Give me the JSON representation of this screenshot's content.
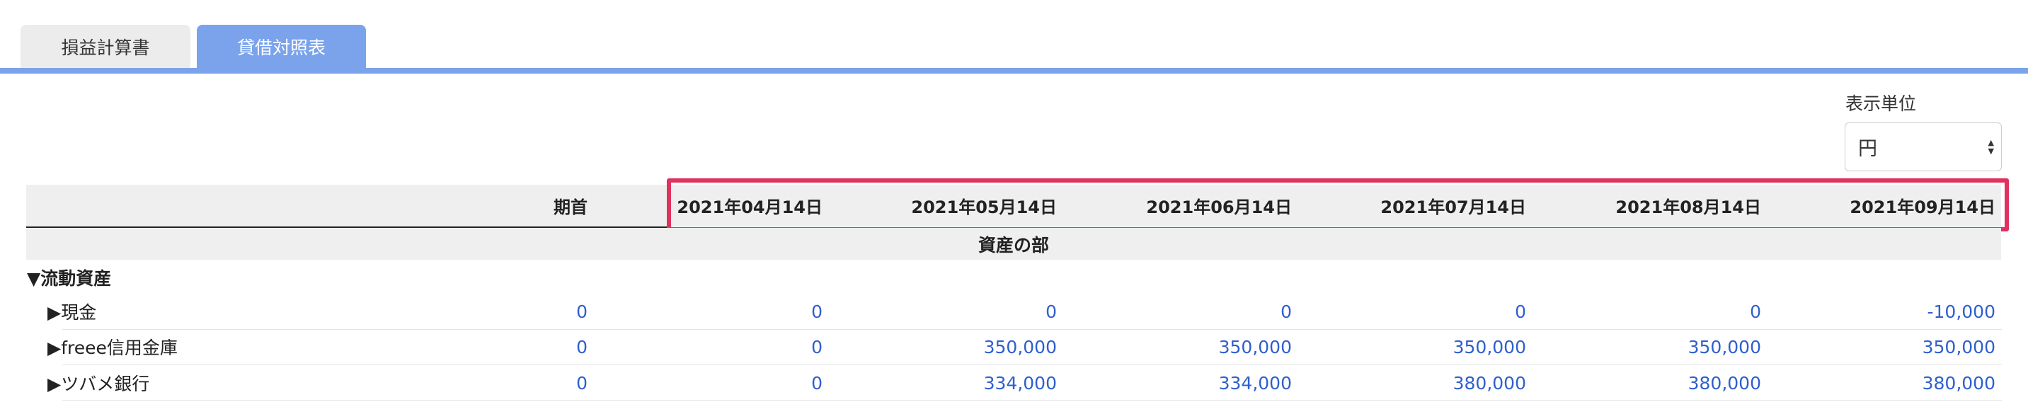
{
  "tabs": {
    "profit_loss": "損益計算書",
    "balance_sheet": "貸借対照表",
    "active": "balance_sheet"
  },
  "display_unit": {
    "label": "表示単位",
    "selected": "円"
  },
  "table": {
    "columns": [
      "期首",
      "2021年04月14日",
      "2021年05月14日",
      "2021年06月14日",
      "2021年07月14日",
      "2021年08月14日",
      "2021年09月14日"
    ],
    "section": "資産の部",
    "group": "▼流動資産",
    "rows": [
      {
        "name": "▶現金",
        "values": [
          "0",
          "0",
          "0",
          "0",
          "0",
          "0",
          "-10,000"
        ]
      },
      {
        "name": "▶freee信用金庫",
        "values": [
          "0",
          "0",
          "350,000",
          "350,000",
          "350,000",
          "350,000",
          "350,000"
        ]
      },
      {
        "name": "▶ツバメ銀行",
        "values": [
          "0",
          "0",
          "334,000",
          "334,000",
          "380,000",
          "380,000",
          "380,000"
        ]
      }
    ]
  },
  "colors": {
    "tab_active": "#7aa3ec",
    "tab_inactive": "#ececec",
    "value_link": "#2e5fce",
    "highlight_border": "#e0315f",
    "header_band": "#f0efef"
  }
}
